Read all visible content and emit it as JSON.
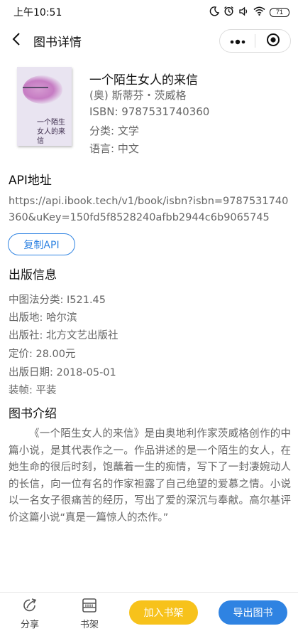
{
  "status_bar": {
    "time": "上午10:51",
    "battery": "71",
    "icons": [
      "moon-icon",
      "alarm-icon",
      "sound-icon",
      "wifi-icon",
      "battery-icon"
    ]
  },
  "nav": {
    "title": "图书详情",
    "icons": [
      "back-arrow-icon",
      "more-dots-icon",
      "target-close-icon"
    ]
  },
  "book": {
    "title": "一个陌生女人的来信",
    "author": "(奥) 斯蒂芬・茨威格",
    "isbn": "ISBN: 9787531740360",
    "category": "分类: 文学",
    "language": "语言: 中文",
    "cover_text": "一个陌生女人的来信"
  },
  "api": {
    "heading": "API地址",
    "url": "https://api.ibook.tech/v1/book/isbn?isbn=9787531740360&uKey=150fd5f8528240afbb2944c6b9065745",
    "copy_button": "复制API"
  },
  "publish": {
    "heading": "出版信息",
    "rows": [
      "中图法分类: I521.45",
      "出版地: 哈尔滨",
      "出版社: 北方文艺出版社",
      "定价: 28.00元",
      "出版日期: 2018-05-01",
      "装帧: 平装"
    ]
  },
  "intro": {
    "heading": "图书介绍",
    "text": "《一个陌生女人的来信》是由奥地利作家茨威格创作的中篇小说，是其代表作之一。作品讲述的是一个陌生的女人，在她生命的很后时刻，饱蘸着一生的痴情，写下了一封凄婉动人的长信，向一位有名的作家袒露了自己绝望的爱慕之情。小说以一名女子很痛苦的经历，写出了爱的深沉与奉献。高尔基评价这篇小说“真是一篇惊人的杰作。”"
  },
  "bottom_bar": {
    "share_label": "分享",
    "shelf_label": "书架",
    "add_to_shelf": "加入书架",
    "export": "导出图书"
  },
  "colors": {
    "accent_blue": "#2f83e2",
    "accent_yellow": "#f7c21b"
  }
}
